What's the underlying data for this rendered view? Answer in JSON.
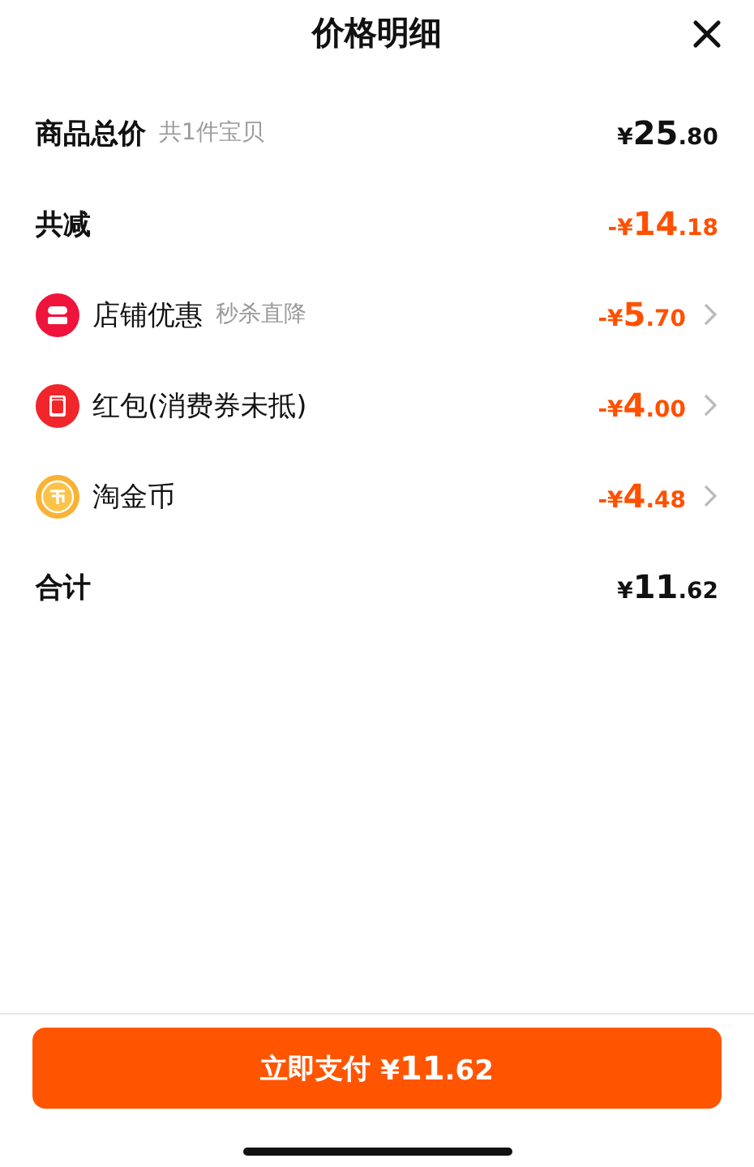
{
  "title": "价格明细",
  "rows": [
    {
      "kind": "sum",
      "label": "商品总价",
      "note": "共1件宝贝",
      "price": {
        "sign": "¥",
        "int": "25",
        "dec": ".80"
      }
    },
    {
      "kind": "reduction",
      "label": "共减",
      "price": {
        "sign": "-¥",
        "int": "14",
        "dec": ".18"
      }
    },
    {
      "kind": "discount",
      "label": "店铺优惠",
      "note": "秒杀直降",
      "price": {
        "sign": "-¥",
        "int": "5",
        "dec": ".70"
      }
    },
    {
      "kind": "discount",
      "label": "红包(消费券未抵)",
      "price": {
        "sign": "-¥",
        "int": "4",
        "dec": ".00"
      }
    },
    {
      "kind": "discount",
      "label": "淘金币",
      "price": {
        "sign": "-¥",
        "int": "4",
        "dec": ".48"
      }
    },
    {
      "kind": "sum",
      "label": "合计",
      "price": {
        "sign": "¥",
        "int": "11",
        "dec": ".62"
      }
    }
  ],
  "pay_button": {
    "label": "立即支付",
    "price": {
      "sign": "¥",
      "int": "11",
      "dec": ".62"
    }
  }
}
